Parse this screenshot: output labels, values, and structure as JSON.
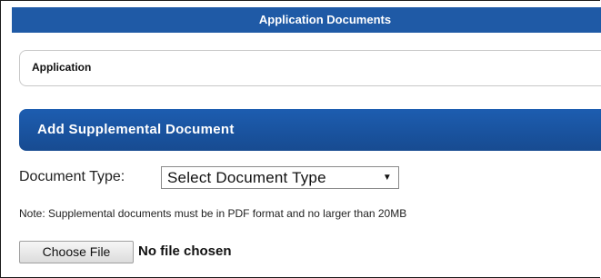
{
  "header": {
    "title": "Application Documents"
  },
  "application_section": {
    "label": "Application"
  },
  "supplemental": {
    "header_label": "Add Supplemental Document",
    "document_type_label": "Document Type:",
    "document_type_selected": "Select Document Type",
    "note": "Note: Supplemental documents must be in PDF format and no larger than 20MB",
    "choose_file_label": "Choose File",
    "file_status": "No file chosen"
  },
  "colors": {
    "title_bar": "#1f5aa6",
    "section_bar": "#1d5db0"
  }
}
